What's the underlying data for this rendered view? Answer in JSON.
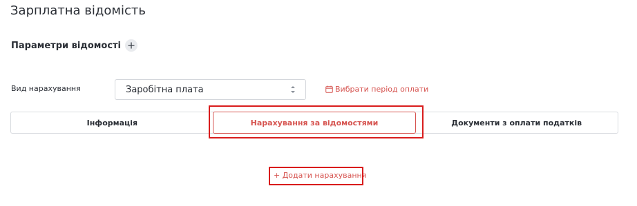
{
  "page": {
    "title": "Зарплатна відомість"
  },
  "params": {
    "section_title": "Параметри відомості",
    "add_icon": "plus-icon"
  },
  "accrual_type": {
    "label": "Вид нарахування",
    "selected_value": "Заробітна плата",
    "arrow_icon": "sort-arrows-icon"
  },
  "period": {
    "link_text": "Вибрати період оплати",
    "icon": "calendar-icon"
  },
  "tabs": [
    {
      "label": "Інформація",
      "active": false
    },
    {
      "label": "Нарахування за відомостями",
      "active": true
    },
    {
      "label": "Документи з оплати податків",
      "active": false
    }
  ],
  "actions": {
    "add_accrual": "+ Додати нарахування"
  },
  "colors": {
    "accent": "#d6534f",
    "highlight": "#d91c1c",
    "border": "#d8dbdf",
    "text": "#2a2e35"
  }
}
